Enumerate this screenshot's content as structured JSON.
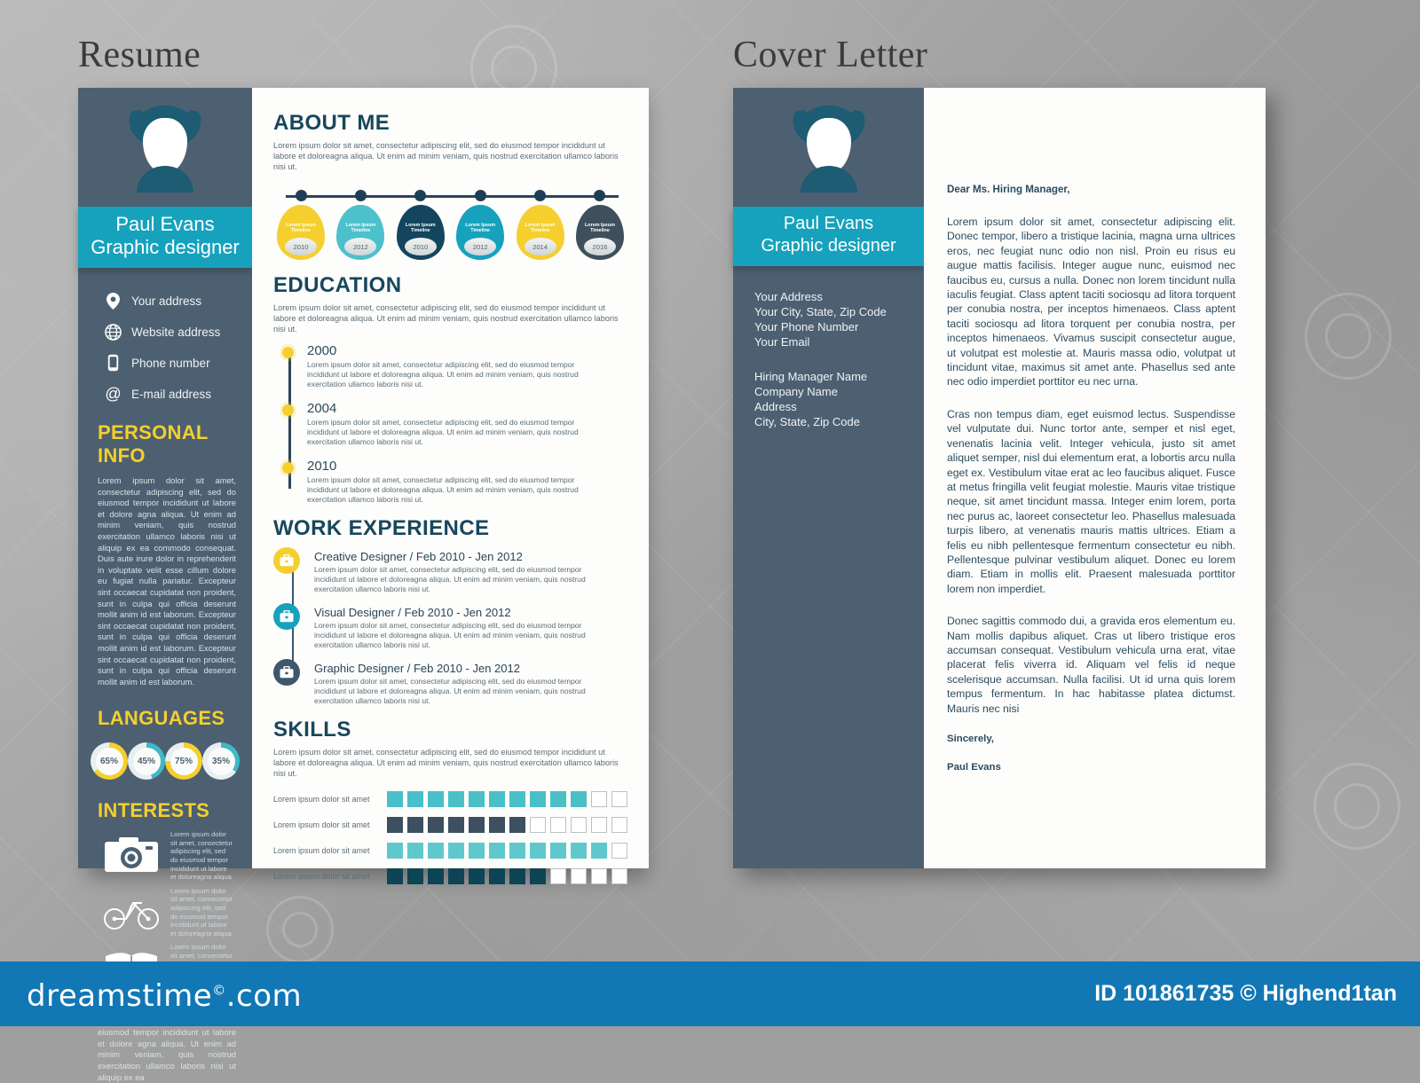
{
  "headings": {
    "resume": "Resume",
    "cover_letter": "Cover Letter"
  },
  "profile": {
    "name": "Paul Evans",
    "title": "Graphic designer"
  },
  "contacts": [
    {
      "icon": "location-pin-icon",
      "label": "Your address"
    },
    {
      "icon": "globe-icon",
      "label": "Website address"
    },
    {
      "icon": "phone-icon",
      "label": "Phone number"
    },
    {
      "icon": "at-sign-icon",
      "label": "E-mail address"
    }
  ],
  "personal_info": {
    "heading": "PERSONAL INFO",
    "body": "Lorem ipsum dolor sit amet, consectetur adipiscing elit, sed do eiusmod tempor incididunt ut labore et dolore agna aliqua. Ut enim ad minim veniam, quis nostrud exercitation ullamco laboris nisi ut aliquip ex ea commodo consequat. Duis aute irure dolor in reprehenderit in voluptate velit esse cillum dolore eu fugiat nulla pariatur. Excepteur sint occaecat cupidatat non proident, sunt in culpa qui officia deserunt mollit anim id est laborum. Excepteur sint occaecat cupidatat non proident, sunt in culpa qui officia deserunt mollit anim id est laborum. Excepteur sint occaecat cupidatat non proident, sunt in culpa qui officia deserunt mollit anim id est laborum."
  },
  "languages": {
    "heading": "LANGUAGES",
    "items": [
      {
        "value": "65%",
        "pct": 65,
        "color": "#f5cf2e"
      },
      {
        "value": "45%",
        "pct": 45,
        "color": "#3fb9c6"
      },
      {
        "value": "75%",
        "pct": 75,
        "color": "#f5cf2e"
      },
      {
        "value": "35%",
        "pct": 35,
        "color": "#3fb9c6"
      }
    ]
  },
  "interests": {
    "heading": "INTERESTS",
    "items": [
      {
        "icon": "camera-icon",
        "text": "Lorem ipsum dolor sit amet, consectetur adipiscing elit, sed do eiusmod tempor incididunt ut labore et doloreagna aliqua."
      },
      {
        "icon": "bicycle-icon",
        "text": "Lorem ipsum dolor sit amet, consectetur adipiscing elit, sed do eiusmod tempor incididunt ut labore et doloreagna aliqua."
      },
      {
        "icon": "book-icon",
        "text": "Lorem ipsum dolor sit amet, consectetur adipiscing elit, sed do eiusmod tempor incididunt ut labore et doloreagna aliqua."
      }
    ]
  },
  "sidebar_footer": "Lorem ipsum dolor sit amet, consectetur adipiscing elit, sed do eiusmod tempor incididunt ut labore et dolore agna aliqua. Ut enim ad minim veniam, quis nostrud exercitation ullamco laboris nisi ut aliquip ex ea",
  "about_me": {
    "heading": "ABOUT ME",
    "body": "Lorem ipsum dolor sit amet, consectetur adipiscing elit, sed do eiusmod tempor incididunt ut labore et doloreagna aliqua. Ut enim ad minim veniam, quis nostrud exercitation ullamco laboris nisi ut."
  },
  "timeline": [
    {
      "label": "Lorem Ipsum Timeline",
      "year": "2010",
      "color": "#f5cf2e"
    },
    {
      "label": "Lorem Ipsum Timeline",
      "year": "2012",
      "color": "#4cc1cc"
    },
    {
      "label": "Lorem Ipsum Timeline",
      "year": "2010",
      "color": "#14455f"
    },
    {
      "label": "Lorem Ipsum Timeline",
      "year": "2012",
      "color": "#16a2bd"
    },
    {
      "label": "Lorem Ipsum Timeline",
      "year": "2014",
      "color": "#f5cf2e"
    },
    {
      "label": "Lorem Ipsum Timeline",
      "year": "2016",
      "color": "#3f4f5c"
    }
  ],
  "education": {
    "heading": "EDUCATION",
    "body": "Lorem ipsum dolor sit amet, consectetur adipiscing elit, sed do eiusmod tempor incididunt ut labore et doloreagna aliqua. Ut enim ad minim veniam, quis nostrud exercitation ullamco laboris nisi ut.",
    "items": [
      {
        "year": "2000",
        "text": "Lorem ipsum dolor sit amet, consectetur adipiscing elit, sed do eiusmod tempor incididunt ut labore  et doloreagna aliqua. Ut enim ad minim veniam, quis nostrud exercitation ullamco laboris nisi ut."
      },
      {
        "year": "2004",
        "text": "Lorem ipsum dolor sit amet, consectetur adipiscing elit, sed do eiusmod tempor incididunt ut labore  et doloreagna aliqua. Ut enim ad minim veniam, quis nostrud exercitation ullamco laboris nisi ut."
      },
      {
        "year": "2010",
        "text": "Lorem ipsum dolor sit amet, consectetur adipiscing elit, sed do eiusmod tempor incididunt ut labore  et doloreagna aliqua. Ut enim ad minim veniam, quis nostrud exercitation ullamco laboris nisi ut."
      }
    ]
  },
  "work_experience": {
    "heading": "WORK EXPERIENCE",
    "items": [
      {
        "title": "Creative Designer  / Feb 2010 - Jen 2012",
        "color": "#f5cf2e",
        "icon": "briefcase-icon",
        "text": "Lorem ipsum dolor sit amet, consectetur adipiscing elit, sed do eiusmod tempor incididunt ut labore  et doloreagna aliqua. Ut enim ad minim veniam, quis nostrud exercitation ullamco laboris nisi ut."
      },
      {
        "title": "Visual Designer  / Feb 2010 - Jen 2012",
        "color": "#16a2bd",
        "icon": "briefcase-icon",
        "text": "Lorem ipsum dolor sit amet, consectetur adipiscing elit, sed do eiusmod tempor incididunt ut labore  et doloreagna aliqua. Ut enim ad minim veniam, quis nostrud exercitation ullamco laboris nisi ut."
      },
      {
        "title": "Graphic Designer  / Feb 2010 - Jen 2012",
        "color": "#3f566b",
        "icon": "briefcase-icon",
        "text": "Lorem ipsum dolor sit amet, consectetur adipiscing elit, sed do eiusmod tempor incididunt ut labore  et doloreagna aliqua. Ut enim ad minim veniam, quis nostrud exercitation ullamco laboris nisi ut."
      }
    ]
  },
  "skills": {
    "heading": "SKILLS",
    "body": "Lorem ipsum dolor sit amet, consectetur adipiscing elit, sed do eiusmod tempor incididunt ut labore et doloreagna aliqua. Ut enim ad minim veniam, quis nostrud exercitation ullamco laboris nisi ut.",
    "rows": [
      {
        "label": "Lorem ipsum dolor sit amet",
        "filled": 10,
        "total": 12,
        "color": "#4bbfc7"
      },
      {
        "label": "Lorem ipsum dolor sit amet",
        "filled": 7,
        "total": 12,
        "color": "#3d4f60"
      },
      {
        "label": "Lorem ipsum dolor sit amet",
        "filled": 11,
        "total": 12,
        "color": "#5fc8cd"
      },
      {
        "label": "Lorem ipsum dolor sit amet",
        "filled": 8,
        "total": 12,
        "color": "#0d4456"
      }
    ]
  },
  "cover_letter": {
    "sender": [
      "Your Address",
      "Your City, State, Zip Code",
      "Your Phone Number",
      "Your Email"
    ],
    "recipient": [
      "Hiring Manager Name",
      "Company Name",
      "Address",
      "City, State, Zip Code"
    ],
    "greeting": "Dear Ms. Hiring Manager,",
    "paragraphs": [
      "Lorem ipsum dolor sit amet, consectetur adipiscing elit. Donec tempor, libero a tristique lacinia, magna urna ultrices eros, nec feugiat nunc odio non nisl. Proin eu risus eu augue mattis facilisis. Integer augue nunc, euismod nec faucibus eu, cursus a nulla. Donec non lorem tincidunt nulla iaculis feugiat. Class aptent taciti sociosqu ad litora torquent per conubia nostra, per inceptos himenaeos. Class aptent taciti sociosqu ad litora torquent per conubia nostra, per inceptos himenaeos. Vivamus suscipit consectetur augue, ut volutpat est molestie at. Mauris massa odio, volutpat ut tincidunt vitae, maximus sit amet ante. Phasellus sed ante nec odio imperdiet porttitor eu nec urna.",
      "Cras non tempus diam, eget euismod lectus. Suspendisse vel vulputate dui. Nunc tortor ante, semper et nisl eget, venenatis lacinia velit. Integer vehicula, justo sit amet aliquet semper, nisl dui elementum erat, a lobortis arcu nulla eget ex. Vestibulum vitae erat ac leo faucibus aliquet. Fusce at metus fringilla velit feugiat molestie. Mauris vitae tristique neque, sit amet tincidunt massa. Integer enim lorem, porta nec purus ac, laoreet consectetur leo. Phasellus malesuada turpis libero, at venenatis mauris mattis ultrices. Etiam a felis eu nibh pellentesque fermentum consectetur eu nibh. Pellentesque pulvinar vestibulum aliquet. Donec eu lorem diam. Etiam in mollis elit. Praesent malesuada porttitor lorem non imperdiet.",
      "Donec sagittis commodo dui, a gravida eros elementum eu. Nam mollis dapibus aliquet. Cras ut libero tristique eros accumsan consequat. Vestibulum vehicula urna erat, vitae placerat felis viverra id. Aliquam vel felis id neque scelerisque accumsan. Nulla facilisi. Ut id urna quis lorem tempus fermentum. In hac habitasse platea dictumst. Mauris nec nisi"
    ],
    "closing": "Sincerely,",
    "signature": "Paul Evans"
  },
  "footer": {
    "brand": "dreamstime.com",
    "credit": "ID 101861735 © Highend1tan"
  }
}
